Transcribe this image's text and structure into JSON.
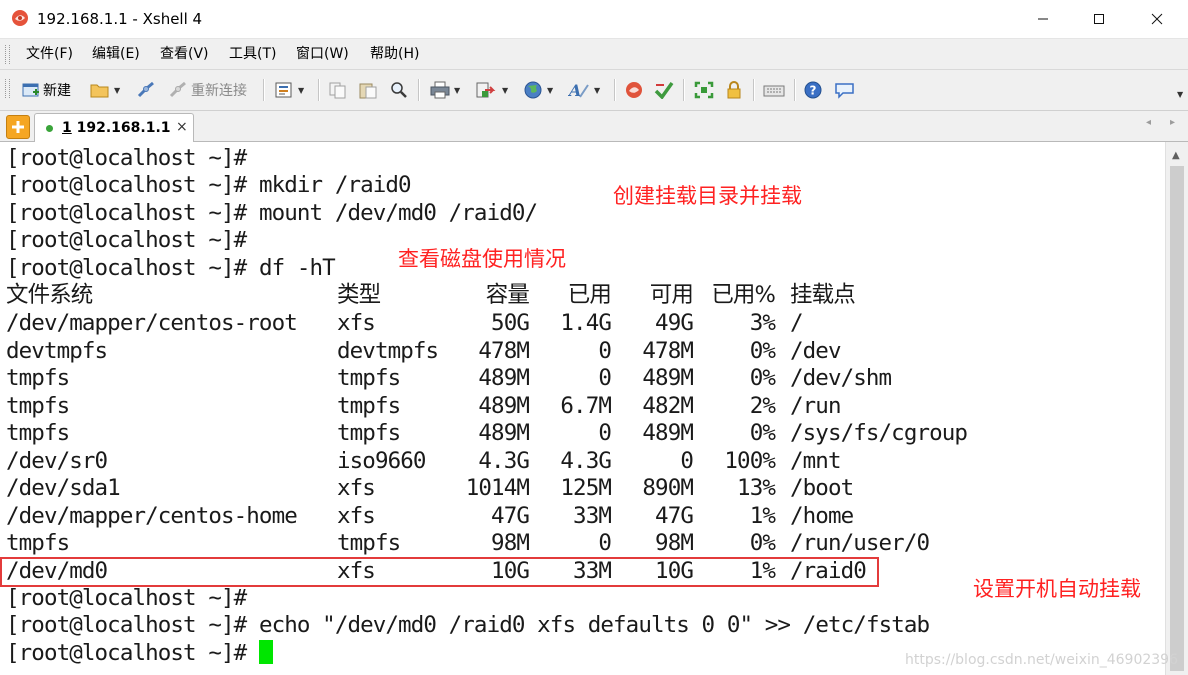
{
  "window": {
    "title": "192.168.1.1 - Xshell 4",
    "controls": [
      "minimize",
      "maximize",
      "close"
    ]
  },
  "menu": {
    "items": [
      "文件(F)",
      "编辑(E)",
      "查看(V)",
      "工具(T)",
      "窗口(W)",
      "帮助(H)"
    ]
  },
  "toolbar": {
    "new_label": "新建",
    "reconnect_label": "重新连接"
  },
  "tabs": {
    "active": {
      "index": "1",
      "host": "192.168.1.1"
    },
    "close_glyph": "×"
  },
  "terminal": {
    "prompt": "[root@localhost ~]#",
    "commands_before": [
      "",
      "mkdir /raid0",
      "mount /dev/md0 /raid0/",
      "",
      "df -hT"
    ],
    "df": {
      "headers": [
        "文件系统",
        "类型",
        "容量",
        "已用",
        "可用",
        "已用%",
        "挂载点"
      ],
      "rows": [
        [
          "/dev/mapper/centos-root",
          "xfs",
          "50G",
          "1.4G",
          "49G",
          "3%",
          "/"
        ],
        [
          "devtmpfs",
          "devtmpfs",
          "478M",
          "0",
          "478M",
          "0%",
          "/dev"
        ],
        [
          "tmpfs",
          "tmpfs",
          "489M",
          "0",
          "489M",
          "0%",
          "/dev/shm"
        ],
        [
          "tmpfs",
          "tmpfs",
          "489M",
          "6.7M",
          "482M",
          "2%",
          "/run"
        ],
        [
          "tmpfs",
          "tmpfs",
          "489M",
          "0",
          "489M",
          "0%",
          "/sys/fs/cgroup"
        ],
        [
          "/dev/sr0",
          "iso9660",
          "4.3G",
          "4.3G",
          "0",
          "100%",
          "/mnt"
        ],
        [
          "/dev/sda1",
          "xfs",
          "1014M",
          "125M",
          "890M",
          "13%",
          "/boot"
        ],
        [
          "/dev/mapper/centos-home",
          "xfs",
          "47G",
          "33M",
          "47G",
          "1%",
          "/home"
        ],
        [
          "tmpfs",
          "tmpfs",
          "98M",
          "0",
          "98M",
          "0%",
          "/run/user/0"
        ],
        [
          "/dev/md0",
          "xfs",
          "10G",
          "33M",
          "10G",
          "1%",
          "/raid0"
        ]
      ]
    },
    "commands_after": [
      "",
      "echo \"/dev/md0 /raid0 xfs defaults 0 0\" >> /etc/fstab",
      ""
    ],
    "cursor_color": "#00e600"
  },
  "annotations": {
    "mount": "创建挂载目录并挂载",
    "df": "查看磁盘使用情况",
    "fstab": "设置开机自动挂载",
    "color": "#ff2222"
  },
  "watermark": "https://blog.csdn.net/weixin_46902396"
}
